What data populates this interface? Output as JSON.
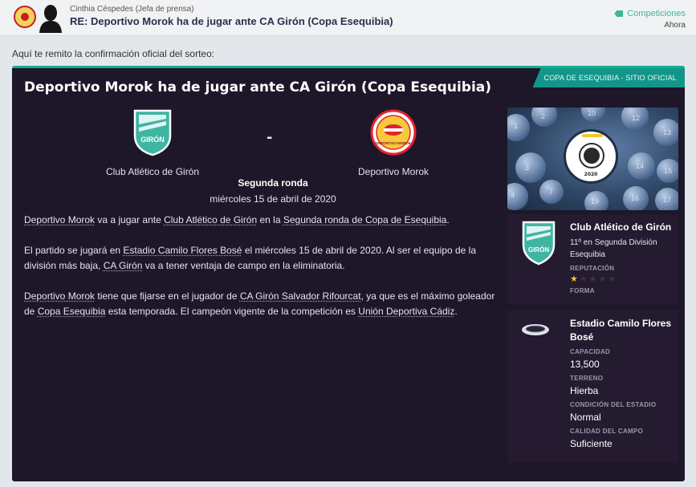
{
  "header": {
    "sender": "Cinthia Céspedes  (Jefa de prensa)",
    "subject": "RE: Deportivo Morok ha de jugar ante CA Girón (Copa Esequibia)",
    "tag": "Competiciones",
    "time": "Ahora"
  },
  "intro": "Aquí te remito la confirmación oficial del sorteo:",
  "article": {
    "source": "COPA DE ESEQUIBIA - SITIO OFICIAL",
    "title": "Deportivo Morok ha de jugar ante CA Girón (Copa Esequibia)",
    "home_team": "Club Atlético de Girón",
    "home_logo_text": "GIRÓN",
    "away_team": "Deportivo Morok",
    "away_logo_text": "DEPORTIVO MOROK",
    "versus": "-",
    "round": "Segunda ronda",
    "date": "miércoles 15 de abril de 2020",
    "p1": {
      "a1": "Deportivo Morok",
      "t1": " va a jugar ante ",
      "a2": "Club Atlético de Girón",
      "t2": " en la ",
      "a3": "Segunda ronda de Copa de Esequibia",
      "t3": "."
    },
    "p2": {
      "t1": "El partido se jugará en ",
      "a1": "Estadio Camilo Flores Bosé",
      "t2": " el miércoles 15 de abril de 2020. Al ser el equipo de la división más baja, ",
      "a2": "CA Girón",
      "t3": " va a tener ventaja de campo en la eliminatoria."
    },
    "p3": {
      "a1": "Deportivo Morok",
      "t1": " tiene que fijarse en el jugador de ",
      "a2": "CA Girón Salvador Rifourcat",
      "t2": ", ya que es el máximo goleador de ",
      "a3": "Copa Esequibia",
      "t3": " esta temporada. El campeón vigente de la competición es ",
      "a4": "Unión Deportiva Cádiz",
      "t4": "."
    }
  },
  "photo": {
    "emblem_year": "2020",
    "numbers": [
      "1",
      "2",
      "3",
      "4",
      "7",
      "10",
      "12",
      "13",
      "14",
      "15",
      "16",
      "17",
      "19"
    ]
  },
  "club_card": {
    "name": "Club Atlético de Girón",
    "logo_text": "GIRÓN",
    "position": "11º en Segunda División Esequibia",
    "reputation_label": "REPUTACIÓN",
    "reputation_stars": 1,
    "reputation_max": 5,
    "form_label": "FORMA"
  },
  "stadium_card": {
    "name": "Estadio Camilo Flores Bosé",
    "capacity_label": "CAPACIDAD",
    "capacity": "13,500",
    "surface_label": "TERRENO",
    "surface": "Hierba",
    "condition_label": "CONDICIÓN DEL ESTADIO",
    "condition": "Normal",
    "pitch_label": "CALIDAD DEL CAMPO",
    "pitch": "Suficiente"
  },
  "colors": {
    "accent": "#12ad95",
    "panel": "#1e1629",
    "card": "#241b30",
    "star": "#f4c531",
    "home_shield": "#3fb6a3",
    "away_badge": "#e3242b"
  }
}
